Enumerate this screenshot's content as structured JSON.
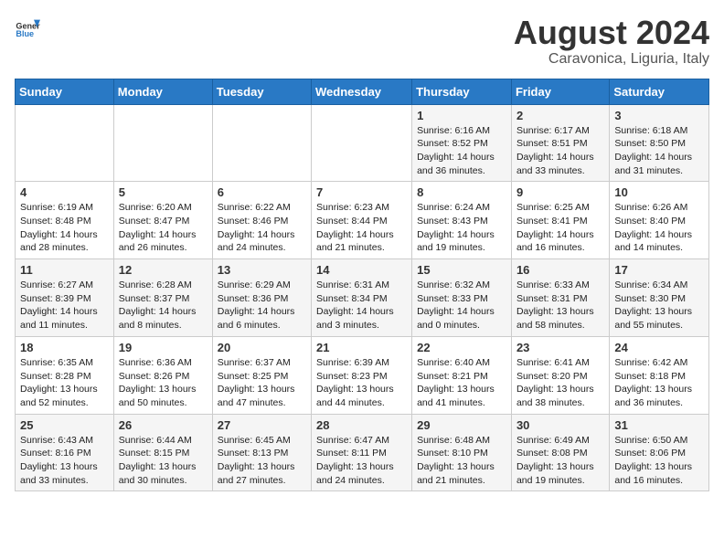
{
  "logo": {
    "line1": "General",
    "line2": "Blue"
  },
  "title": "August 2024",
  "location": "Caravonica, Liguria, Italy",
  "days_of_week": [
    "Sunday",
    "Monday",
    "Tuesday",
    "Wednesday",
    "Thursday",
    "Friday",
    "Saturday"
  ],
  "weeks": [
    [
      {
        "day": "",
        "detail": ""
      },
      {
        "day": "",
        "detail": ""
      },
      {
        "day": "",
        "detail": ""
      },
      {
        "day": "",
        "detail": ""
      },
      {
        "day": "1",
        "detail": "Sunrise: 6:16 AM\nSunset: 8:52 PM\nDaylight: 14 hours\nand 36 minutes."
      },
      {
        "day": "2",
        "detail": "Sunrise: 6:17 AM\nSunset: 8:51 PM\nDaylight: 14 hours\nand 33 minutes."
      },
      {
        "day": "3",
        "detail": "Sunrise: 6:18 AM\nSunset: 8:50 PM\nDaylight: 14 hours\nand 31 minutes."
      }
    ],
    [
      {
        "day": "4",
        "detail": "Sunrise: 6:19 AM\nSunset: 8:48 PM\nDaylight: 14 hours\nand 28 minutes."
      },
      {
        "day": "5",
        "detail": "Sunrise: 6:20 AM\nSunset: 8:47 PM\nDaylight: 14 hours\nand 26 minutes."
      },
      {
        "day": "6",
        "detail": "Sunrise: 6:22 AM\nSunset: 8:46 PM\nDaylight: 14 hours\nand 24 minutes."
      },
      {
        "day": "7",
        "detail": "Sunrise: 6:23 AM\nSunset: 8:44 PM\nDaylight: 14 hours\nand 21 minutes."
      },
      {
        "day": "8",
        "detail": "Sunrise: 6:24 AM\nSunset: 8:43 PM\nDaylight: 14 hours\nand 19 minutes."
      },
      {
        "day": "9",
        "detail": "Sunrise: 6:25 AM\nSunset: 8:41 PM\nDaylight: 14 hours\nand 16 minutes."
      },
      {
        "day": "10",
        "detail": "Sunrise: 6:26 AM\nSunset: 8:40 PM\nDaylight: 14 hours\nand 14 minutes."
      }
    ],
    [
      {
        "day": "11",
        "detail": "Sunrise: 6:27 AM\nSunset: 8:39 PM\nDaylight: 14 hours\nand 11 minutes."
      },
      {
        "day": "12",
        "detail": "Sunrise: 6:28 AM\nSunset: 8:37 PM\nDaylight: 14 hours\nand 8 minutes."
      },
      {
        "day": "13",
        "detail": "Sunrise: 6:29 AM\nSunset: 8:36 PM\nDaylight: 14 hours\nand 6 minutes."
      },
      {
        "day": "14",
        "detail": "Sunrise: 6:31 AM\nSunset: 8:34 PM\nDaylight: 14 hours\nand 3 minutes."
      },
      {
        "day": "15",
        "detail": "Sunrise: 6:32 AM\nSunset: 8:33 PM\nDaylight: 14 hours\nand 0 minutes."
      },
      {
        "day": "16",
        "detail": "Sunrise: 6:33 AM\nSunset: 8:31 PM\nDaylight: 13 hours\nand 58 minutes."
      },
      {
        "day": "17",
        "detail": "Sunrise: 6:34 AM\nSunset: 8:30 PM\nDaylight: 13 hours\nand 55 minutes."
      }
    ],
    [
      {
        "day": "18",
        "detail": "Sunrise: 6:35 AM\nSunset: 8:28 PM\nDaylight: 13 hours\nand 52 minutes."
      },
      {
        "day": "19",
        "detail": "Sunrise: 6:36 AM\nSunset: 8:26 PM\nDaylight: 13 hours\nand 50 minutes."
      },
      {
        "day": "20",
        "detail": "Sunrise: 6:37 AM\nSunset: 8:25 PM\nDaylight: 13 hours\nand 47 minutes."
      },
      {
        "day": "21",
        "detail": "Sunrise: 6:39 AM\nSunset: 8:23 PM\nDaylight: 13 hours\nand 44 minutes."
      },
      {
        "day": "22",
        "detail": "Sunrise: 6:40 AM\nSunset: 8:21 PM\nDaylight: 13 hours\nand 41 minutes."
      },
      {
        "day": "23",
        "detail": "Sunrise: 6:41 AM\nSunset: 8:20 PM\nDaylight: 13 hours\nand 38 minutes."
      },
      {
        "day": "24",
        "detail": "Sunrise: 6:42 AM\nSunset: 8:18 PM\nDaylight: 13 hours\nand 36 minutes."
      }
    ],
    [
      {
        "day": "25",
        "detail": "Sunrise: 6:43 AM\nSunset: 8:16 PM\nDaylight: 13 hours\nand 33 minutes."
      },
      {
        "day": "26",
        "detail": "Sunrise: 6:44 AM\nSunset: 8:15 PM\nDaylight: 13 hours\nand 30 minutes."
      },
      {
        "day": "27",
        "detail": "Sunrise: 6:45 AM\nSunset: 8:13 PM\nDaylight: 13 hours\nand 27 minutes."
      },
      {
        "day": "28",
        "detail": "Sunrise: 6:47 AM\nSunset: 8:11 PM\nDaylight: 13 hours\nand 24 minutes."
      },
      {
        "day": "29",
        "detail": "Sunrise: 6:48 AM\nSunset: 8:10 PM\nDaylight: 13 hours\nand 21 minutes."
      },
      {
        "day": "30",
        "detail": "Sunrise: 6:49 AM\nSunset: 8:08 PM\nDaylight: 13 hours\nand 19 minutes."
      },
      {
        "day": "31",
        "detail": "Sunrise: 6:50 AM\nSunset: 8:06 PM\nDaylight: 13 hours\nand 16 minutes."
      }
    ]
  ]
}
